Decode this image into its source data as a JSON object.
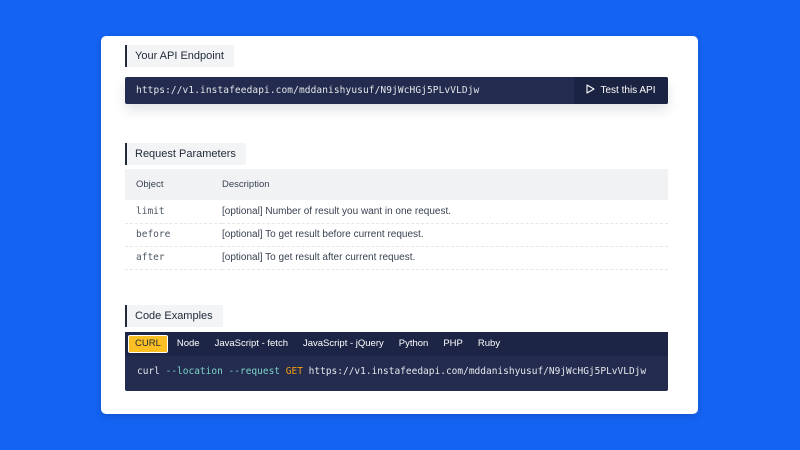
{
  "colors": {
    "background": "#1463f3",
    "card": "#ffffff",
    "dark_panel": "#232c4f",
    "active_tab": "#fbbf24"
  },
  "endpoint": {
    "label": "Your API Endpoint",
    "url": "https://v1.instafeedapi.com/mddanishyusuf/N9jWcHGj5PLvVLDjw",
    "test_button_label": "Test this API",
    "test_button_icon": "play-outline-icon"
  },
  "params": {
    "label": "Request Parameters",
    "headers": [
      "Object",
      "Description"
    ],
    "rows": [
      {
        "object": "limit",
        "description": "[optional] Number of result you want in one request."
      },
      {
        "object": "before",
        "description": "[optional] To get result before current request."
      },
      {
        "object": "after",
        "description": "[optional] To get result after current request."
      }
    ]
  },
  "code": {
    "label": "Code Examples",
    "tabs": [
      "CURL",
      "Node",
      "JavaScript - fetch",
      "JavaScript - jQuery",
      "Python",
      "PHP",
      "Ruby"
    ],
    "active_tab": "CURL",
    "snippet": {
      "cmd": "curl ",
      "flag_location": "--location",
      "flag_request": "--request",
      "method": "GET",
      "url": "https://v1.instafeedapi.com/mddanishyusuf/N9jWcHGj5PLvVLDjw"
    }
  }
}
